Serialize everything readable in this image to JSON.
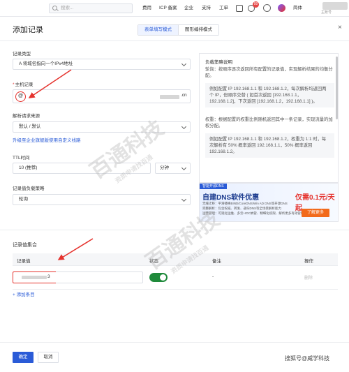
{
  "topbar": {
    "search_placeholder": "搜索...",
    "nav": [
      "费用",
      "ICP 备案",
      "企业",
      "支持",
      "工单"
    ],
    "badge_count": "99",
    "lang": "简体",
    "user_sub": "主账号"
  },
  "dialog": {
    "title": "添加记录",
    "tabs": [
      "表单填写模式",
      "图形编排模式"
    ],
    "close_label": "×"
  },
  "form": {
    "record_type": {
      "label": "记录类型",
      "value": "A 将域名指向一个IPv4地址"
    },
    "host": {
      "label": "主机记录",
      "prefix": "@",
      "suffix": ".cn"
    },
    "line": {
      "label": "解析请求来源",
      "value": "默认 / 默认"
    },
    "upgrade_link": "升级至企业旗舰版使用自定义线路",
    "ttl": {
      "label": "TTL时间",
      "value": "10 (推荐)",
      "unit": "分钟"
    },
    "lb_policy": {
      "label": "记录值负载策略",
      "value": "轮询"
    }
  },
  "help": {
    "title": "负载策略说明",
    "p1": "轮询：按顺序逐次返回所有配置的记录值，实现解析结果的均衡分配。",
    "ex1": "例如配置 IP 192.168.1.1 和 192.168.1.2，每次解析均返回两个 IP，但顺序交替 ( 如首次返回 [192.168.1.1，192.168.1.2]，下次返回 [192.168.1.2，192.168.1.1] )。",
    "p2": "权重：根据配置的权重比例随机返回其中一条记录，实现流量的加权分配。",
    "ex2": "例如配置 IP 192.168.1.1 和 192.168.1.2，权重为 1:1 时，每次解析有 50% 概率返回 192.168.1.1，50% 概率返回 192.168.1.2。"
  },
  "banner": {
    "tag": "智能开源DNS",
    "title": "自建DNS软件优惠",
    "line1": "无缝迁移：平滑替换BIND/CoreDNS/Win AD DNS等开源DNS",
    "line2": "完整解析：包含权威、转发、递归DNS等全场景解析能力",
    "line3": "运营管理：可观化运维、多云+IDC纳管、精细化权限、解析更多有效管理",
    "price": "仅需0.1元/天起",
    "button": "了解更多"
  },
  "records": {
    "section_title": "记录值集合",
    "columns": [
      "记录值",
      "状态",
      "备注",
      "操作"
    ],
    "rows": [
      {
        "value_suffix": "3",
        "remark": "-",
        "action": "删除"
      }
    ],
    "add_link": "+ 添加条目"
  },
  "footer": {
    "confirm": "确定",
    "cancel": "取消",
    "corner_watermark": "搜狐号@威学科技"
  },
  "watermark": {
    "text": "百通科技",
    "sub": "资质申请找百通"
  },
  "colors": {
    "primary": "#2a5bd7",
    "annotation_red": "#e5322d",
    "toggle_on": "#1f8a3b"
  }
}
